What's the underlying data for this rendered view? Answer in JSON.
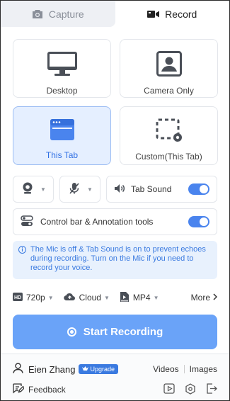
{
  "tabs": {
    "capture_label": "Capture",
    "record_label": "Record"
  },
  "sources": [
    {
      "label": "Desktop",
      "icon": "monitor-icon"
    },
    {
      "label": "Camera Only",
      "icon": "camera-portrait-icon"
    },
    {
      "label": "This Tab",
      "icon": "browser-tab-icon",
      "selected": true
    },
    {
      "label": "Custom(This Tab)",
      "icon": "custom-area-icon"
    }
  ],
  "controls": {
    "tab_sound_label": "Tab Sound",
    "tab_sound_on": true,
    "control_bar_label": "Control bar & Annotation tools",
    "control_bar_on": true
  },
  "notice": {
    "text": "The Mic is off & Tab Sound is on to prevent echoes during recording. Turn on the Mic if you need to record your voice."
  },
  "options": {
    "resolution": "720p",
    "storage": "Cloud",
    "format": "MP4",
    "more_label": "More"
  },
  "start_button": "Start Recording",
  "footer": {
    "user_name": "Eien Zhang",
    "upgrade_label": "Upgrade",
    "videos_label": "Videos",
    "images_label": "Images",
    "feedback_label": "Feedback"
  },
  "colors": {
    "accent": "#4a84ee",
    "start_button": "#6aa3f8",
    "selected_card_bg": "#e5efff",
    "notice_bg": "#e8f1fd"
  }
}
